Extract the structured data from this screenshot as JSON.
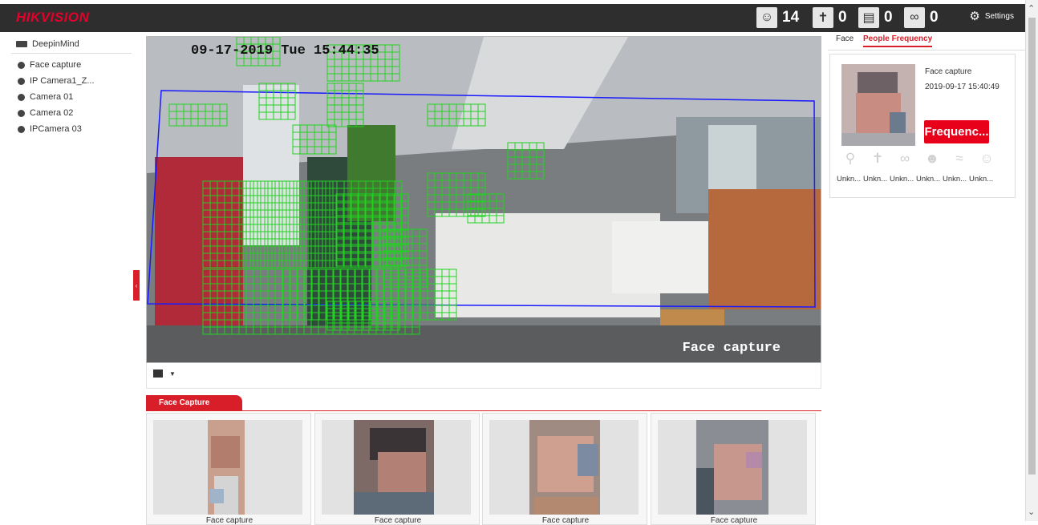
{
  "header": {
    "logo_text": "HIKVISION",
    "stats": [
      {
        "icon": "person-icon",
        "value": "14"
      },
      {
        "icon": "pedestrian-icon",
        "value": "0"
      },
      {
        "icon": "car-icon",
        "value": "0"
      },
      {
        "icon": "bicycle-icon",
        "value": "0"
      }
    ],
    "settings_label": "Settings"
  },
  "sidebar": {
    "root_label": "DeepinMind",
    "items": [
      {
        "label": "Face capture"
      },
      {
        "label": "IP Camera1_Z..."
      },
      {
        "label": "Camera 01"
      },
      {
        "label": "Camera 02"
      },
      {
        "label": "IPCamera 03"
      }
    ]
  },
  "video": {
    "timestamp": "09-17-2019 Tue 15:44:35",
    "osd_label": "Face capture"
  },
  "face_capture": {
    "tab_label": "Face Capture",
    "cards": [
      {
        "caption": "Face capture"
      },
      {
        "caption": "Face capture"
      },
      {
        "caption": "Face capture"
      },
      {
        "caption": "Face capture"
      }
    ]
  },
  "right_panel": {
    "tabs": [
      {
        "label": "Face"
      },
      {
        "label": "People Frequency"
      }
    ],
    "active_tab": "People Frequency",
    "card": {
      "type": "Face capture",
      "time": "2019-09-17 15:40:49",
      "frequency_button": "Frequenc...",
      "attributes": [
        {
          "icon": "age-icon",
          "label": "Unkn..."
        },
        {
          "icon": "gender-icon",
          "label": "Unkn..."
        },
        {
          "icon": "glasses-icon",
          "label": "Unkn..."
        },
        {
          "icon": "mask-icon",
          "label": "Unkn..."
        },
        {
          "icon": "mustache-icon",
          "label": "Unkn..."
        },
        {
          "icon": "smile-icon",
          "label": "Unkn..."
        }
      ]
    }
  },
  "colors": {
    "brand_red": "#d81e28",
    "topbar": "#2e2e2e",
    "detection_grid": "#21d321",
    "roi_line": "#1a1aff"
  }
}
